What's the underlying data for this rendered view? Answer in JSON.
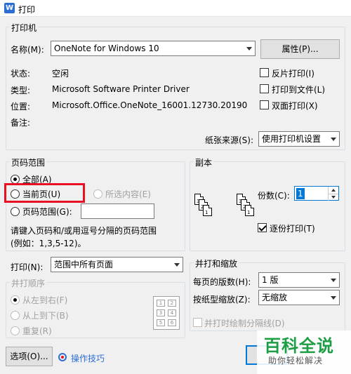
{
  "window": {
    "title": "打印",
    "app_icon_letter": "W"
  },
  "printer": {
    "group_title": "打印机",
    "name_label": "名称(M):",
    "name_value": "OneNote for Windows 10",
    "properties_button": "属性(P)...",
    "status_label": "状态:",
    "status_value": "空闲",
    "type_label": "类型:",
    "type_value": "Microsoft Software Printer Driver",
    "location_label": "位置:",
    "location_value": "Microsoft.Office.OneNote_16001.12730.20190",
    "comment_label": "备注:",
    "reverse_print": "反片打印(I)",
    "print_to_file": "打印到文件(L)",
    "duplex": "双面打印(X)",
    "paper_source_label": "纸张来源(S):",
    "paper_source_value": "使用打印机设置"
  },
  "page_range": {
    "group_title": "页码范围",
    "all": "全部(A)",
    "current_page": "当前页(U)",
    "selection": "所选内容(E)",
    "pages": "页码范围(G):",
    "pages_value": "",
    "hint_line1": "请键入页码和/或用逗号分隔的页码范围",
    "hint_line2": "(例如：1,3,5-12)。",
    "print_label": "打印(N):",
    "print_value": "范围中所有页面"
  },
  "copies": {
    "group_title": "副本",
    "count_label": "份数(C):",
    "count_value": "1",
    "collate": "逐份打印(T)",
    "page_numbers": [
      "3",
      "2",
      "1",
      "3",
      "2",
      "1"
    ]
  },
  "print_order": {
    "group_title": "并打顺序",
    "left_to_right": "从左到右(F)",
    "top_to_bottom": "从上到下(B)",
    "repeat": "重复(R)",
    "grid_numbers": [
      "1",
      "2",
      "3",
      "4",
      "5",
      "6"
    ]
  },
  "zoom": {
    "group_title": "并打和缩放",
    "pages_per_sheet_label": "每页的版数(H):",
    "pages_per_sheet_value": "1 版",
    "scale_label": "按纸型缩放(Z):",
    "scale_value": "无缩放",
    "draw_borders": "并打时绘制分隔线(D)"
  },
  "footer": {
    "options_button": "选项(O)...",
    "tips_link": "操作技巧"
  },
  "watermark": {
    "big": "百科全说",
    "small": "助你轻松解决"
  },
  "colors": {
    "highlight": "#e81123",
    "accent": "#0078d7",
    "watermark_green": "#1d9e45"
  }
}
